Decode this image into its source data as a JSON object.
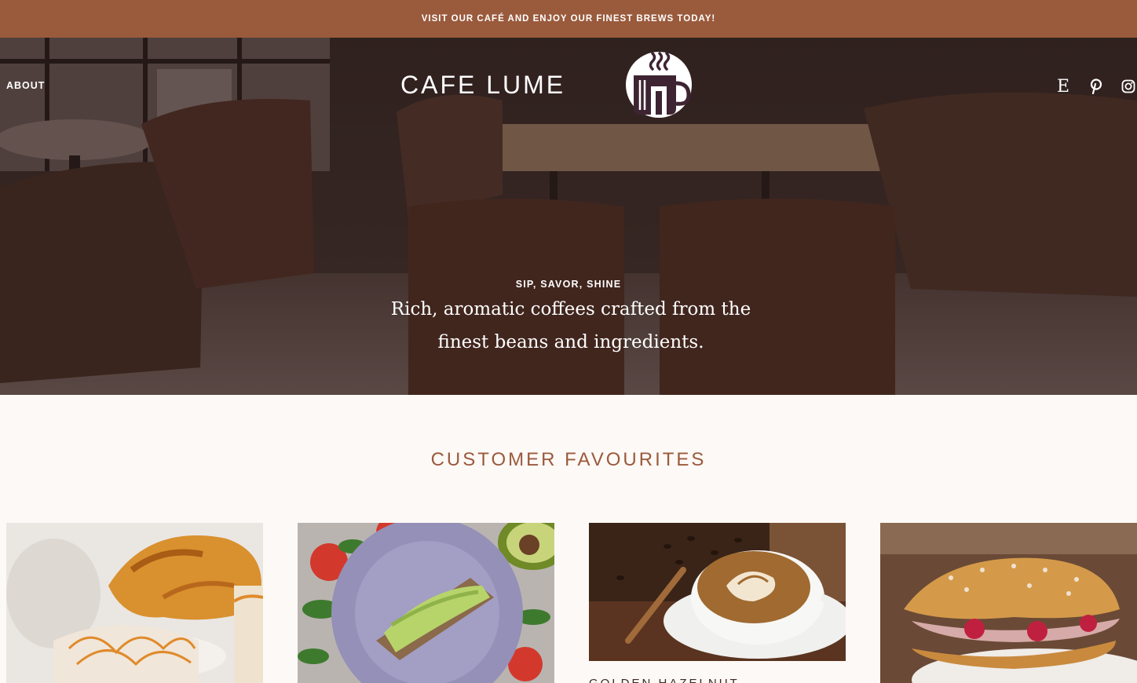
{
  "announcement": "VISIT OUR CAFÉ AND ENJOY OUR FINEST BREWS TODAY!",
  "nav": {
    "about": "ABOUT"
  },
  "brand": {
    "name": "CAFE LUME",
    "logo_icon": "coffee-cup-logo"
  },
  "social": [
    {
      "name": "etsy-icon",
      "glyph": "E"
    },
    {
      "name": "pinterest-icon"
    },
    {
      "name": "instagram-icon"
    }
  ],
  "hero": {
    "tagline": "SIP, SAVOR, SHINE",
    "text": "Rich, aromatic coffees crafted from the finest beans and ingredients."
  },
  "favourites": {
    "title": "CUSTOMER FAVOURITES",
    "items": [
      {
        "image": "caramel-latte-croissant-photo"
      },
      {
        "image": "avocado-toast-photo"
      },
      {
        "image": "latte-art-photo",
        "title": "GOLDEN HAZELNUT"
      },
      {
        "image": "raspberry-croissant-photo"
      }
    ]
  },
  "colors": {
    "accent": "#9a5a3c",
    "background": "#fdf9f6"
  }
}
